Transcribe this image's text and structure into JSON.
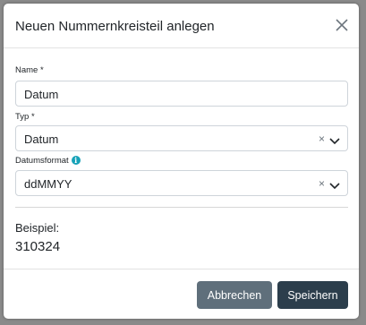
{
  "dialog": {
    "title": "Neuen Nummernkreisteil anlegen"
  },
  "form": {
    "name": {
      "label": "Name *",
      "value": "Datum"
    },
    "type": {
      "label": "Typ *",
      "value": "Datum",
      "clear": "×"
    },
    "date_format": {
      "label": "Datumsformat",
      "info": "i",
      "value": "ddMMYY",
      "clear": "×"
    }
  },
  "example": {
    "label": "Beispiel:",
    "value": "310324"
  },
  "footer": {
    "cancel_label": "Abbrechen",
    "save_label": "Speichern"
  },
  "colors": {
    "cancel_button": "#5f6f7b",
    "save_button": "#2c3e4c",
    "info_icon": "#17a2b8"
  }
}
